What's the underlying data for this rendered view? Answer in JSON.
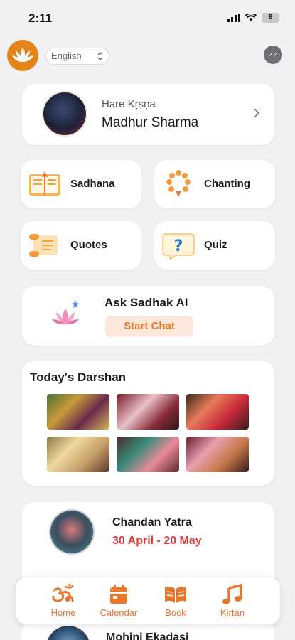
{
  "status_bar": {
    "time": "2:11",
    "battery": "8"
  },
  "header": {
    "language": "English"
  },
  "profile": {
    "greeting": "Hare Kṛṣṇa",
    "name": "Madhur Sharma"
  },
  "tiles": [
    {
      "label": "Sadhana",
      "icon": "book-icon"
    },
    {
      "label": "Chanting",
      "icon": "beads-icon"
    },
    {
      "label": "Quotes",
      "icon": "scroll-icon"
    },
    {
      "label": "Quiz",
      "icon": "question-icon"
    }
  ],
  "ai": {
    "title": "Ask Sadhak AI",
    "button": "Start Chat"
  },
  "darshan": {
    "title": "Today's Darshan"
  },
  "festival": {
    "name": "Chandan Yatra",
    "dates": "30 April - 20 May"
  },
  "next_festival": {
    "name": "Mohini Ekadasi"
  },
  "nav": [
    {
      "label": "Home",
      "icon": "om-icon"
    },
    {
      "label": "Calendar",
      "icon": "calendar-icon"
    },
    {
      "label": "Book",
      "icon": "book-open-icon"
    },
    {
      "label": "Kirtan",
      "icon": "music-icon"
    }
  ],
  "colors": {
    "accent": "#e8762c",
    "date_red": "#e03a3a",
    "background": "#f1f1f3"
  }
}
